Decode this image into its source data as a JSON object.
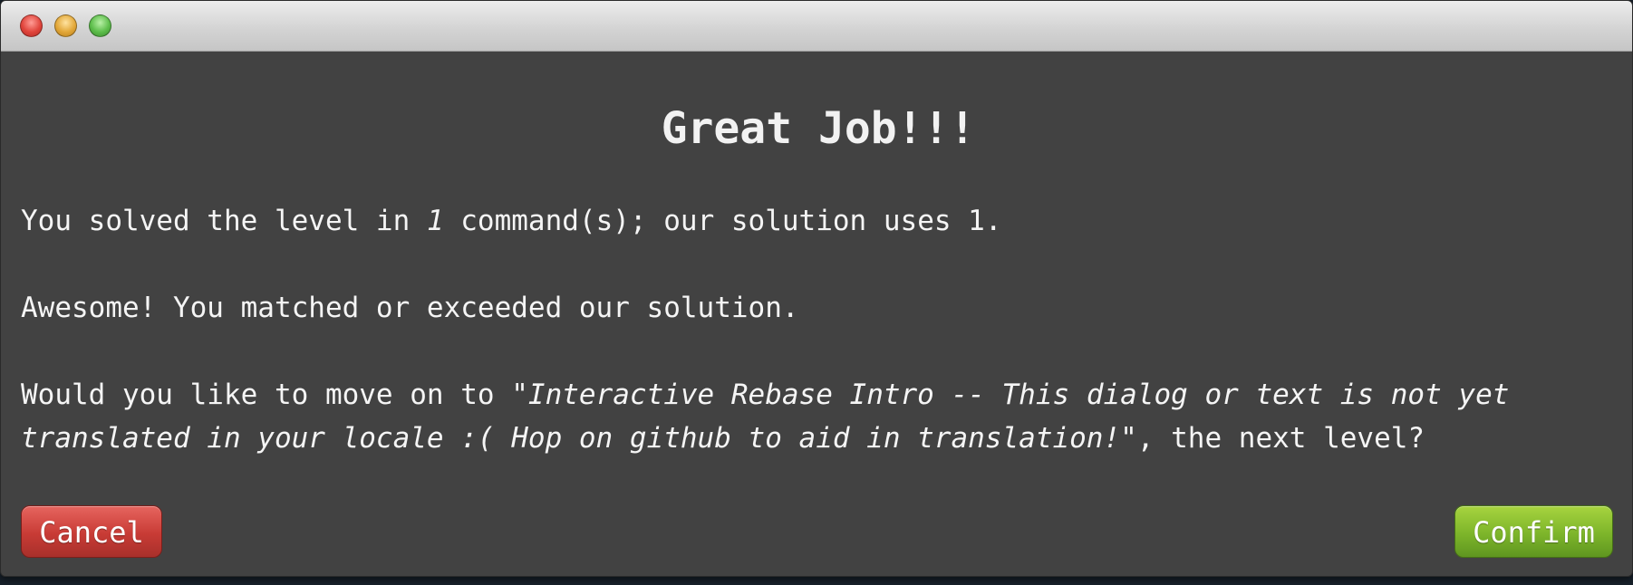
{
  "dialog": {
    "heading": "Great Job!!!",
    "line1": {
      "before": "You solved the level in ",
      "count": "1",
      "after": " command(s); our solution uses 1."
    },
    "line2": "Awesome! You matched or exceeded our solution.",
    "line3": {
      "before": "Would you like to move on to \"",
      "level_part1": "Interactive Rebase Intro -- This dialog or text is not yet",
      "level_part2": "translated in your locale :( Hop on github to aid in translation!",
      "after": "\", the next level?"
    }
  },
  "buttons": {
    "cancel": "Cancel",
    "confirm": "Confirm"
  },
  "colors": {
    "window_bg": "#424242",
    "cancel": "#c83b35",
    "confirm": "#7db52a"
  },
  "icons": [
    "close-window-icon",
    "minimize-window-icon",
    "maximize-window-icon"
  ]
}
